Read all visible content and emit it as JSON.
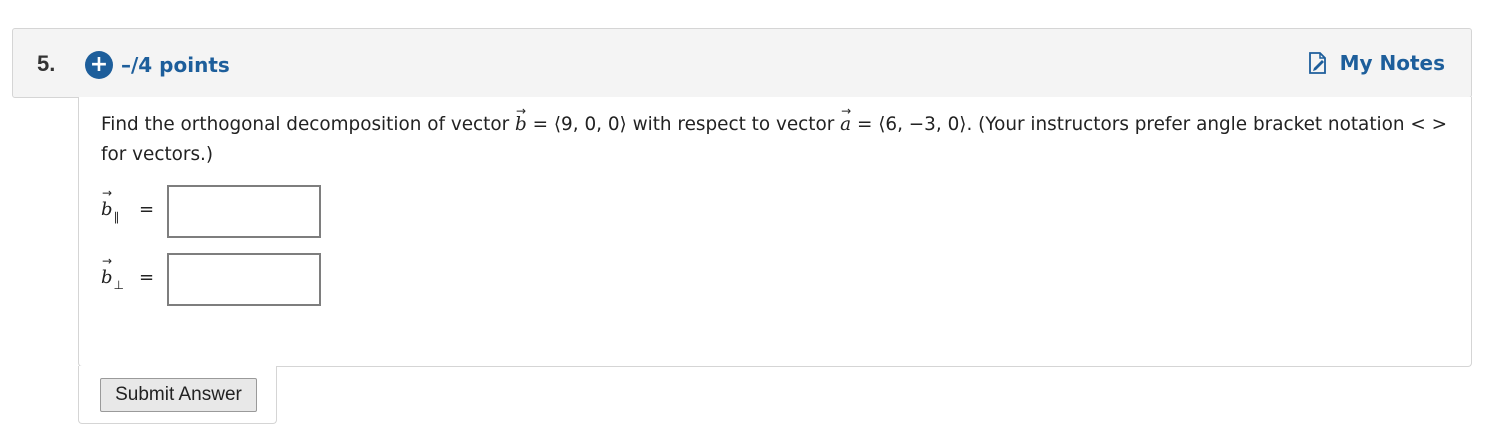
{
  "question": {
    "number": "5.",
    "points_label": "–/4 points",
    "plus_icon": "plus-circle-icon",
    "my_notes_label": "My Notes",
    "notes_icon": "note-edit-icon",
    "prompt": {
      "part1": "Find the orthogonal decomposition of vector ",
      "vector_b_symbol": "b",
      "part2": " = ⟨9, 0, 0⟩ with respect to vector ",
      "vector_a_symbol": "a",
      "part3": " = ⟨6, −3, 0⟩. (Your instructors prefer angle bracket notation < > for vectors.)"
    },
    "vector_arrow": "⃗",
    "answers": [
      {
        "symbol": "b",
        "subscript": "∥",
        "equals": "=",
        "value": "",
        "placeholder": ""
      },
      {
        "symbol": "b",
        "subscript": "⊥",
        "equals": "=",
        "value": "",
        "placeholder": ""
      }
    ],
    "submit_label": "Submit Answer"
  },
  "colors": {
    "accent": "#1d5e9b",
    "header_bg": "#f4f4f4",
    "border": "#d5d5d5"
  }
}
